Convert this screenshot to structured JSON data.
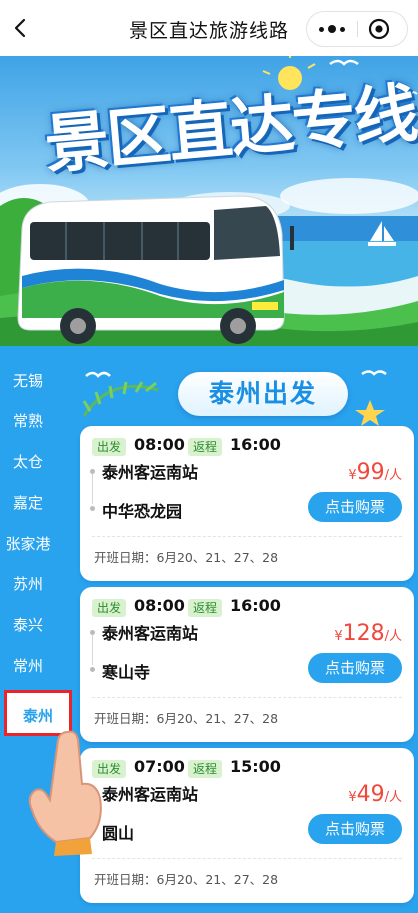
{
  "nav": {
    "title": "景区直达旅游线路",
    "back_icon": "chevron-left-icon",
    "more_icon": "more-dots-icon",
    "close_icon": "target-close-icon"
  },
  "banner": {
    "title": "景区直达专线"
  },
  "sidebar": {
    "items": [
      {
        "label": "无锡"
      },
      {
        "label": "常熟"
      },
      {
        "label": "太仓"
      },
      {
        "label": "嘉定"
      },
      {
        "label": "张家港"
      },
      {
        "label": "苏州"
      },
      {
        "label": "泰兴"
      },
      {
        "label": "常州"
      },
      {
        "label": "泰州"
      }
    ],
    "active": "泰州"
  },
  "section": {
    "title": "泰州出发"
  },
  "routes": [
    {
      "depart_tag": "出发",
      "depart_time": "08:00",
      "return_tag": "返程",
      "return_time": "16:00",
      "from": "泰州客运南站",
      "to": "中华恐龙园",
      "currency": "¥",
      "price": "99",
      "unit": "/人",
      "button": "点击购票",
      "dates": "开班日期：6月20、21、27、28"
    },
    {
      "depart_tag": "出发",
      "depart_time": "08:00",
      "return_tag": "返程",
      "return_time": "16:00",
      "from": "泰州客运南站",
      "to": "寒山寺",
      "currency": "¥",
      "price": "128",
      "unit": "/人",
      "button": "点击购票",
      "dates": "开班日期：6月20、21、27、28"
    },
    {
      "depart_tag": "出发",
      "depart_time": "07:00",
      "return_tag": "返程",
      "return_time": "15:00",
      "from": "泰州客运南站",
      "to": "圆山",
      "currency": "¥",
      "price": "49",
      "unit": "/人",
      "button": "点击购票",
      "dates": "开班日期：6月20、21、27、28"
    }
  ],
  "colors": {
    "accent": "#2aa3ef",
    "price": "#f0483a",
    "tag_bg": "#d8f2d0",
    "highlight_border": "#e8242c"
  }
}
